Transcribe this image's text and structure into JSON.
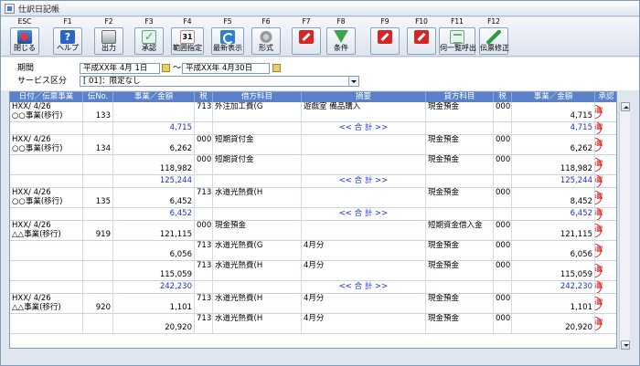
{
  "window": {
    "title": "仕訳日記帳"
  },
  "toolbar": [
    {
      "key": "ESC",
      "label": "閉じる",
      "icon": "exit-icon"
    },
    {
      "key": "F1",
      "label": "ヘルプ",
      "icon": "help-icon"
    },
    {
      "key": "F2",
      "label": "出力",
      "icon": "print-icon"
    },
    {
      "key": "F3",
      "label": "承認",
      "icon": "approve-icon"
    },
    {
      "key": "F4",
      "label": "範囲指定",
      "icon": "calendar-icon"
    },
    {
      "key": "F5",
      "label": "最新表示",
      "icon": "refresh-icon"
    },
    {
      "key": "F6",
      "label": "形式",
      "icon": "gear-icon"
    },
    {
      "key": "F7",
      "label": "",
      "icon": "prohibited-icon"
    },
    {
      "key": "F8",
      "label": "条件",
      "icon": "filter-icon"
    },
    {
      "key": "F9",
      "label": "",
      "icon": "prohibited-icon"
    },
    {
      "key": "F10",
      "label": "",
      "icon": "prohibited-icon"
    },
    {
      "key": "F11",
      "label": "伺一覧呼出",
      "icon": "list-icon"
    },
    {
      "key": "F12",
      "label": "伝票修正",
      "icon": "edit-icon"
    }
  ],
  "filters": {
    "period_label": "期間",
    "period_from": "平成XX年 4月 1日",
    "period_sep": "～",
    "period_to": "平成XX年 4月30日",
    "service_label": "サービス区分",
    "service_value": "[     01]：限定なし"
  },
  "columns": [
    "日付／伝票事業",
    "伝No.",
    "事業／金額",
    "税",
    "借方科目",
    "摘要",
    "貸方科目",
    "税",
    "事業／金額",
    "承認"
  ],
  "rows": [
    {
      "h": 22,
      "date": "HXX/ 4/26",
      "biz": "○○事業(移行)",
      "no": "133",
      "dTax": "713",
      "dAcct": "外注加工費(G",
      "memo": "遊戯室  備品購入",
      "cAcct": "現金預金",
      "cTax": "000",
      "cAmt": "4,715",
      "seal": "承認"
    },
    {
      "h": 14,
      "dAmtBlue": "4,715",
      "memo": "<< 合  計 >>",
      "memoBlue": true,
      "cAmtBlue": "4,715",
      "seal": "承認"
    },
    {
      "h": 22,
      "date": "HXX/ 4/26",
      "biz": "○○事業(移行)",
      "no": "134",
      "dAmt": "6,262",
      "dTax": "000",
      "dAcct": "短期貸付金",
      "cAcct": "現金預金",
      "cTax": "000",
      "cAmt": "6,262",
      "seal": "承認"
    },
    {
      "h": 22,
      "dAmt": "118,982",
      "dTax": "000",
      "dAcct": "短期貸付金",
      "cAcct": "現金預金",
      "cTax": "000",
      "cAmt": "118,982",
      "seal": "承認"
    },
    {
      "h": 14,
      "dAmtBlue": "125,244",
      "memo": "<< 合  計 >>",
      "memoBlue": true,
      "cAmtBlue": "125,244",
      "seal": "承認"
    },
    {
      "h": 22,
      "date": "HXX/ 4/26",
      "biz": "○○事業(移行)",
      "no": "135",
      "dAmt": "6,452",
      "dTax": "713",
      "dAcct": "水道光熱費(H",
      "cAcct": "現金預金",
      "cTax": "000",
      "cAmt": "8,452",
      "seal": "承認"
    },
    {
      "h": 14,
      "dAmtBlue": "6,452",
      "memo": "<< 合  計 >>",
      "memoBlue": true,
      "cAmtBlue": "6,452",
      "seal": "承認"
    },
    {
      "h": 22,
      "date": "HXX/ 4/26",
      "biz": "△△事業(移行)",
      "no": "919",
      "dAmt": "121,115",
      "dTax": "000",
      "dAcct": "現金預金",
      "cAcct": "短期資金借入金",
      "cTax": "000",
      "cAmt": "121,115",
      "seal": "承認"
    },
    {
      "h": 22,
      "dAmt": "6,056",
      "dTax": "713",
      "dAcct": "水道光熱費(G",
      "memo": "4月分",
      "cAcct": "現金預金",
      "cTax": "000",
      "cAmt": "6,056",
      "seal": "承認"
    },
    {
      "h": 22,
      "dAmt": "115,059",
      "dTax": "713",
      "dAcct": "水道光熱費(H",
      "memo": "4月分",
      "cAcct": "現金預金",
      "cTax": "000",
      "cAmt": "115,059",
      "seal": "承認"
    },
    {
      "h": 14,
      "dAmtBlue": "242,230",
      "memo": "<< 合  計 >>",
      "memoBlue": true,
      "cAmtBlue": "242,230",
      "seal": "承認"
    },
    {
      "h": 22,
      "date": "HXX/ 4/26",
      "biz": "△△事業(移行)",
      "no": "920",
      "dAmt": "1,101",
      "dTax": "713",
      "dAcct": "水道光熱費(H",
      "memo": "4月分",
      "cAcct": "現金預金",
      "cTax": "000",
      "cAmt": "1,101",
      "seal": "承認"
    },
    {
      "h": 22,
      "dAmt": "20,920",
      "dTax": "713",
      "dAcct": "水道光熱費(H",
      "memo": "4月分",
      "cAcct": "現金預金",
      "cTax": "000",
      "cAmt": "20,920",
      "seal": "承認"
    }
  ]
}
